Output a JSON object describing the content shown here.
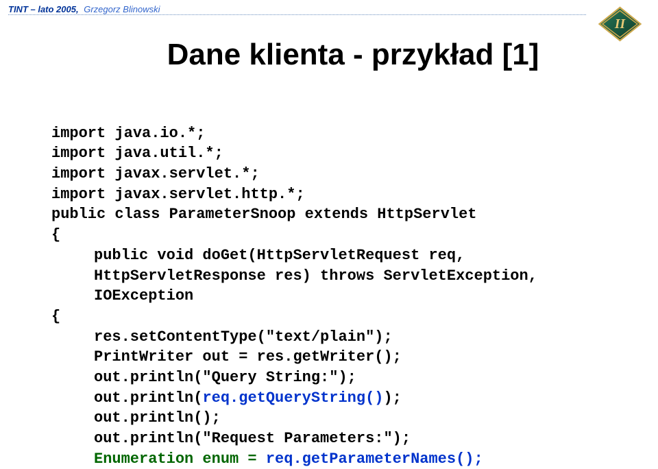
{
  "header": {
    "course": "TINT – lato 2005,",
    "author": "Grzegorz Blinowski"
  },
  "title": "Dane klienta - przykład [1]",
  "code": {
    "l1": "import java.io.*;",
    "l2": "import java.util.*;",
    "l3": "import javax.servlet.*;",
    "l4": "import javax.servlet.http.*;",
    "l5": "public class ParameterSnoop extends HttpServlet",
    "l6": "{",
    "l7a": "public void doGet(HttpServletRequest req,",
    "l7b": "HttpServletResponse res) throws ServletException,",
    "l7c": "IOException",
    "l8": "{",
    "l9": "res.setContentType(\"text/plain\");",
    "l10": "PrintWriter out = res.getWriter();",
    "l11": "out.println(\"Query String:\");",
    "l12a": "out.println(",
    "l12b": "req.getQueryString()",
    "l12c": ");",
    "l13": "out.println();",
    "l14": "out.println(\"Request Parameters:\");",
    "l15a": "Enumeration enum = ",
    "l15b": "req.getParameterNames();"
  }
}
